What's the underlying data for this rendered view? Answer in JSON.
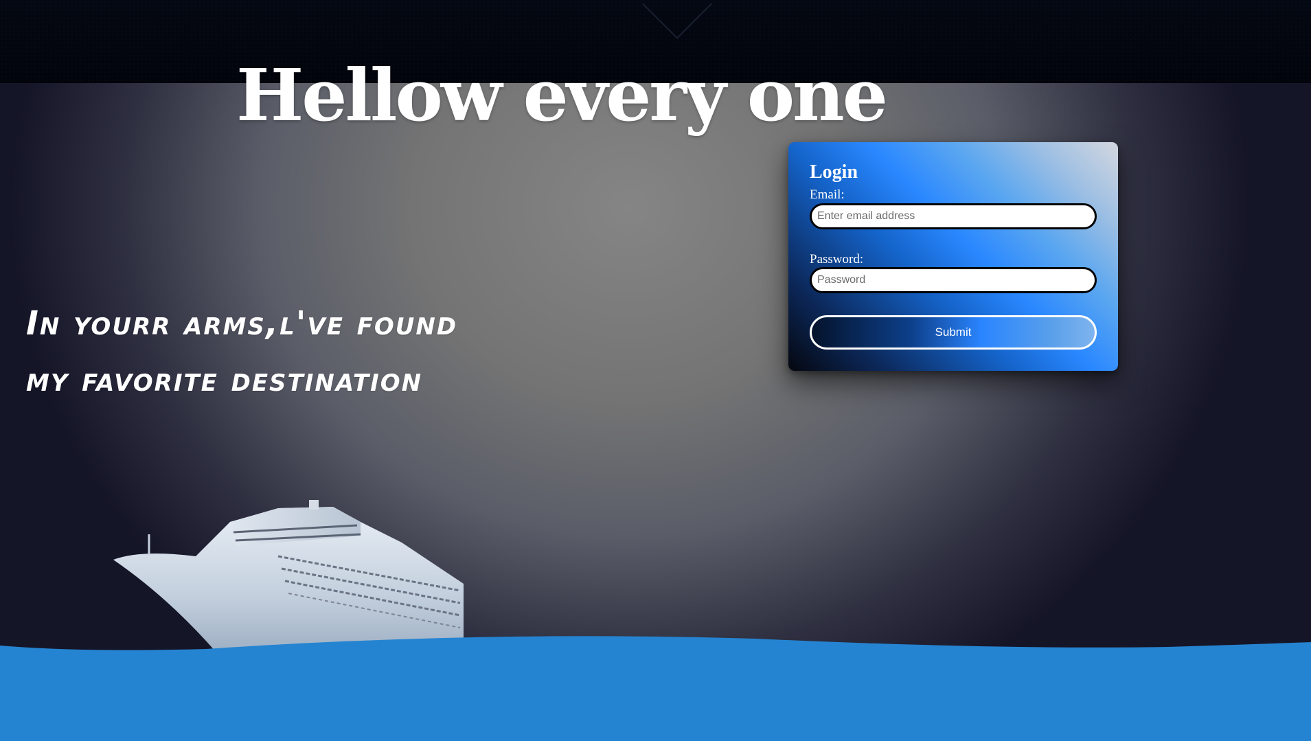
{
  "hero": {
    "title": "Hellow every one"
  },
  "tagline": {
    "line1": "In yourr arms,l've found",
    "line2": "my favorite destination"
  },
  "login": {
    "title": "Login",
    "email_label": "Email:",
    "email_placeholder": "Enter email address",
    "email_value": "",
    "password_label": "Password:",
    "password_placeholder": "Password",
    "password_value": "",
    "submit_label": "Submit"
  },
  "images": {
    "ship": "cruise-ship-illustration",
    "wave": "blue-sea-wave"
  },
  "colors": {
    "sea": "#2584d1",
    "top_band": "#03060f",
    "card_accent": "#2a88ff"
  }
}
